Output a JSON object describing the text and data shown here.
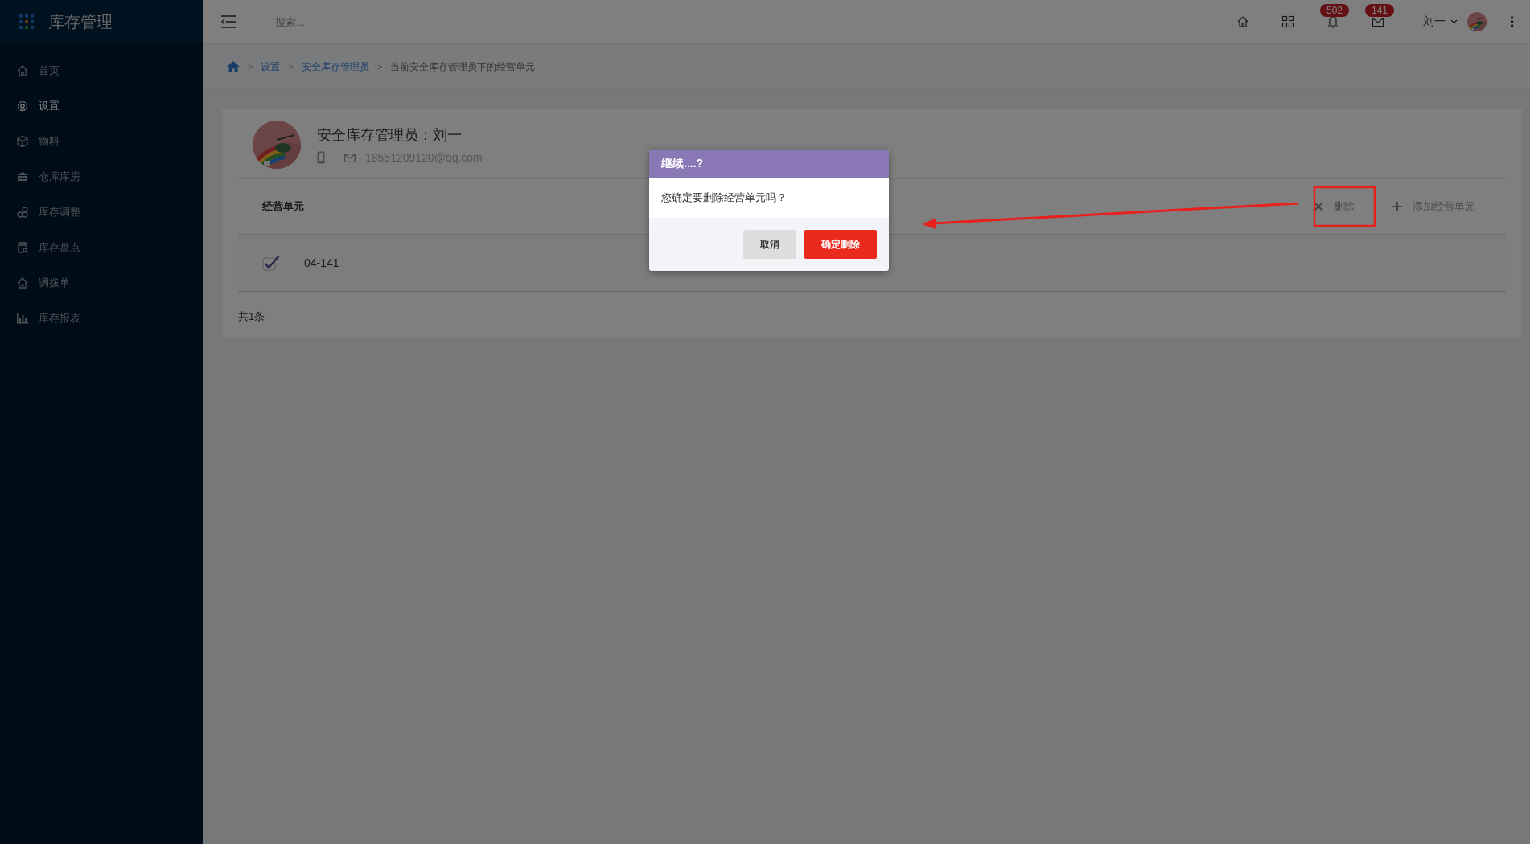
{
  "sidebar": {
    "title": "库存管理",
    "items": [
      {
        "label": "首页",
        "selected": false
      },
      {
        "label": "设置",
        "selected": true
      },
      {
        "label": "物料",
        "selected": false
      },
      {
        "label": "仓库库房",
        "selected": false
      },
      {
        "label": "库存调整",
        "selected": false
      },
      {
        "label": "库存盘点",
        "selected": false
      },
      {
        "label": "调拨单",
        "selected": false
      },
      {
        "label": "库存报表",
        "selected": false
      }
    ]
  },
  "topbar": {
    "search": {
      "placeholder": "搜索..."
    },
    "notifications": "502",
    "messages": "141",
    "user": "刘一"
  },
  "breadcrumb_separator": ">",
  "breadcrumb": [
    "设置",
    "安全库存管理员",
    "当前安全库存管理员下的经营单元"
  ],
  "profile": {
    "title": "安全库存管理员：刘一",
    "email": "18551209120@qq.com"
  },
  "section": {
    "label": "经营单元",
    "actions": [
      "删除",
      "添加经营单元"
    ]
  },
  "rows": [
    {
      "checked": true,
      "code": "04-141"
    }
  ],
  "total": "共1条",
  "dialog": {
    "title": "继续....?",
    "message": "您确定要删除经营单元吗？",
    "buttons": [
      {
        "label": "取消",
        "kind": "cancel"
      },
      {
        "label": "确定删除",
        "kind": "danger"
      }
    ]
  }
}
